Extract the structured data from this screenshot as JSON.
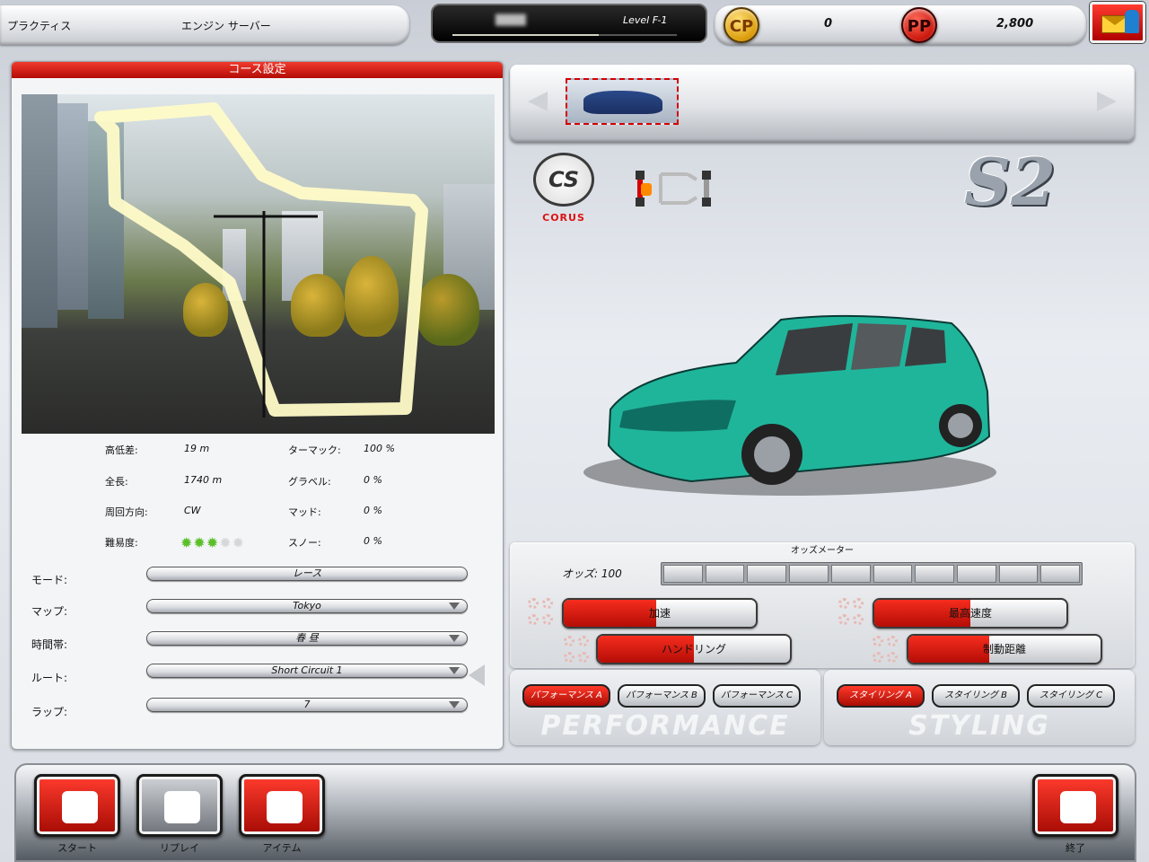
{
  "topbar": {
    "mode": "プラクティス",
    "server": "エンジン サーバー",
    "player_name": "████",
    "level": "Level F-1",
    "xp_progress": 0.65,
    "cp_label": "CP",
    "cp_value": "0",
    "pp_label": "PP",
    "pp_value": "2,800",
    "mail_icon": "mail-icon"
  },
  "course": {
    "header": "コース設定",
    "stats": [
      {
        "label": "高低差:",
        "value": "19 m"
      },
      {
        "label": "全長:",
        "value": "1740 m"
      },
      {
        "label": "周回方向:",
        "value": "CW"
      },
      {
        "label": "難易度:",
        "stars_filled": 3,
        "stars_total": 5
      }
    ],
    "surfaces": [
      {
        "label": "ターマック:",
        "value": "100 %"
      },
      {
        "label": "グラベル:",
        "value": "0 %"
      },
      {
        "label": "マッド:",
        "value": "0 %"
      },
      {
        "label": "スノー:",
        "value": "0 %"
      }
    ],
    "fields": [
      {
        "label": "モード:",
        "value": "レース"
      },
      {
        "label": "マップ:",
        "value": "Tokyo"
      },
      {
        "label": "時間帯:",
        "value": "春 昼"
      },
      {
        "label": "ルート:",
        "value": "Short Circuit 1"
      },
      {
        "label": "ラップ:",
        "value": "7"
      }
    ]
  },
  "car": {
    "brand": "CORUS",
    "brand_mark": "CS",
    "model": "S2",
    "body_color": "#1fb59b",
    "thumb_color": "#2a4a8a"
  },
  "odds": {
    "title": "オッズメーター",
    "label": "オッズ: 100",
    "segments": 10,
    "bars": [
      {
        "label": "加速",
        "value": 0.48
      },
      {
        "label": "最高速度",
        "value": 0.5
      },
      {
        "label": "ハンドリング",
        "value": 0.5
      },
      {
        "label": "制動距離",
        "value": 0.42
      }
    ]
  },
  "tuning": {
    "performance_watermark": "PERFORMANCE",
    "styling_watermark": "STYLING",
    "performance_buttons": [
      "パフォーマンス A",
      "パフォーマンス B",
      "パフォーマンス C"
    ],
    "styling_buttons": [
      "スタイリング A",
      "スタイリング B",
      "スタイリング C"
    ]
  },
  "bottom": {
    "start": "スタート",
    "replay": "リプレイ",
    "item": "アイテム",
    "exit": "終了"
  },
  "colors": {
    "accent_red": "#d8140a",
    "coin_gold": "#e0a510"
  }
}
